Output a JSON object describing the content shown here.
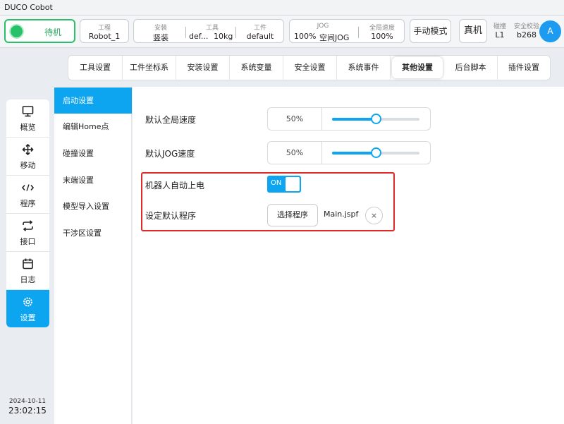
{
  "app": {
    "title": "DUCO Cobot"
  },
  "status": {
    "state": "待机"
  },
  "project": {
    "caption": "工程",
    "value": "Robot_1"
  },
  "install": {
    "caption": "安装",
    "value": "竖装"
  },
  "tool": {
    "caption": "工具",
    "name": "def...",
    "weight": "10kg"
  },
  "workpiece": {
    "caption": "工件",
    "value": "default"
  },
  "jog": {
    "caption": "JOG",
    "value": "100%",
    "space": "空间JOG"
  },
  "global_speed": {
    "caption": "全局速度",
    "value": "100%"
  },
  "mode": {
    "manual": "手动模式",
    "real": "真机"
  },
  "collision": {
    "caption": "碰撞",
    "value": "L1"
  },
  "safety_check": {
    "caption": "安全校验",
    "value": "b268"
  },
  "user": {
    "avatar": "A"
  },
  "tabs": [
    {
      "label": "工具设置"
    },
    {
      "label": "工件坐标系"
    },
    {
      "label": "安装设置"
    },
    {
      "label": "系统变量"
    },
    {
      "label": "安全设置"
    },
    {
      "label": "系统事件"
    },
    {
      "label": "其他设置"
    },
    {
      "label": "后台脚本"
    },
    {
      "label": "插件设置"
    }
  ],
  "nav": [
    {
      "label": "概览",
      "icon": "monitor-icon"
    },
    {
      "label": "移动",
      "icon": "move-arrows-icon"
    },
    {
      "label": "程序",
      "icon": "code-icon"
    },
    {
      "label": "接口",
      "icon": "swap-arrows-icon"
    },
    {
      "label": "日志",
      "icon": "calendar-icon"
    },
    {
      "label": "设置",
      "icon": "gear-icon"
    }
  ],
  "submenu": [
    {
      "label": "启动设置"
    },
    {
      "label": "编辑Home点"
    },
    {
      "label": "碰撞设置"
    },
    {
      "label": "末端设置"
    },
    {
      "label": "模型导入设置"
    },
    {
      "label": "干涉区设置"
    }
  ],
  "settings": {
    "global_speed_label": "默认全局速度",
    "global_speed_value": "50%",
    "global_speed_level": 50,
    "jog_speed_label": "默认JOG速度",
    "jog_speed_value": "50%",
    "jog_speed_level": 50,
    "auto_power_label": "机器人自动上电",
    "auto_power_state": "ON",
    "default_program_label": "设定默认程序",
    "select_program_button": "选择程序",
    "program_name": "Main.jspf",
    "clear_symbol": "×"
  },
  "datetime": {
    "date": "2024-10-11",
    "time": "23:02:15"
  },
  "colors": {
    "accent": "#0ea5f0",
    "status_green": "#25c26a",
    "highlight_red": "#e02a2a"
  }
}
